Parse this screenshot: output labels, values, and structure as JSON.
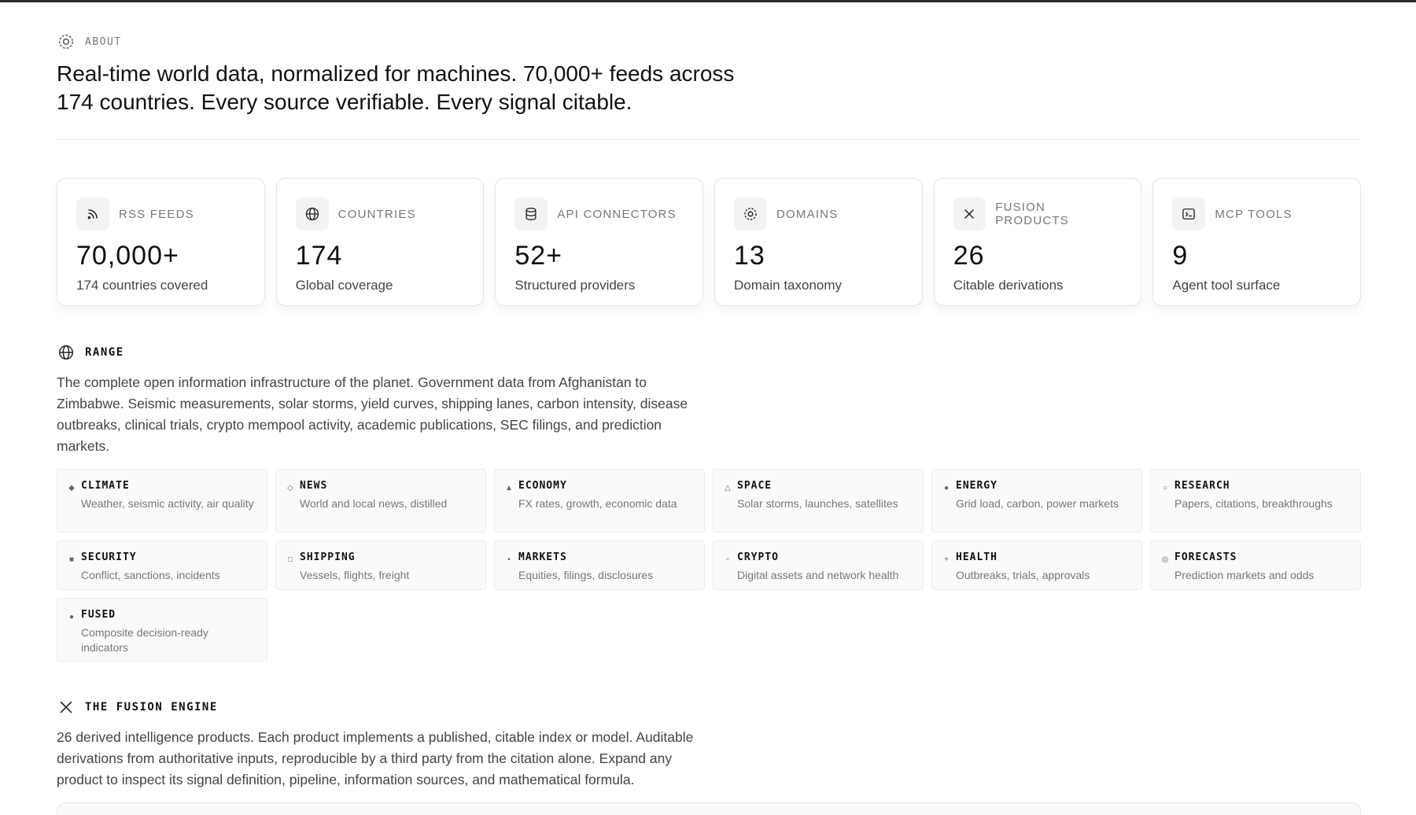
{
  "about": {
    "label": "ABOUT",
    "headline": "Real-time world data, normalized for machines. 70,000+ feeds across 174 countries. Every source verifiable. Every signal citable."
  },
  "stats": [
    {
      "icon": "rss-icon",
      "label": "RSS FEEDS",
      "value": "70,000+",
      "sub": "174 countries covered"
    },
    {
      "icon": "globe-icon",
      "label": "COUNTRIES",
      "value": "174",
      "sub": "Global coverage"
    },
    {
      "icon": "database-icon",
      "label": "API CONNECTORS",
      "value": "52+",
      "sub": "Structured providers"
    },
    {
      "icon": "target-icon",
      "label": "DOMAINS",
      "value": "13",
      "sub": "Domain taxonomy"
    },
    {
      "icon": "fusion-icon",
      "label": "FUSION PRODUCTS",
      "value": "26",
      "sub": "Citable derivations"
    },
    {
      "icon": "terminal-icon",
      "label": "MCP TOOLS",
      "value": "9",
      "sub": "Agent tool surface"
    }
  ],
  "range": {
    "label": "RANGE",
    "text": "The complete open information infrastructure of the planet. Government data from Afghanistan to Zimbabwe. Seismic measurements, solar storms, yield curves, shipping lanes, carbon intensity, disease outbreaks, clinical trials, crypto mempool activity, academic publications, SEC filings, and prediction markets."
  },
  "domains": [
    {
      "mark": "◆",
      "name": "CLIMATE",
      "desc": "Weather, seismic activity, air quality"
    },
    {
      "mark": "◇",
      "name": "NEWS",
      "desc": "World and local news, distilled"
    },
    {
      "mark": "▲",
      "name": "ECONOMY",
      "desc": "FX rates, growth, economic data"
    },
    {
      "mark": "△",
      "name": "SPACE",
      "desc": "Solar storms, launches, satellites"
    },
    {
      "mark": "●",
      "name": "ENERGY",
      "desc": "Grid load, carbon, power markets"
    },
    {
      "mark": "○",
      "name": "RESEARCH",
      "desc": "Papers, citations, breakthroughs"
    },
    {
      "mark": "■",
      "name": "SECURITY",
      "desc": "Conflict, sanctions, incidents"
    },
    {
      "mark": "□",
      "name": "SHIPPING",
      "desc": "Vessels, flights, freight"
    },
    {
      "mark": "▪",
      "name": "MARKETS",
      "desc": "Equities, filings, disclosures"
    },
    {
      "mark": "▫",
      "name": "CRYPTO",
      "desc": "Digital assets and network health"
    },
    {
      "mark": "+",
      "name": "HEALTH",
      "desc": "Outbreaks, trials, approvals"
    },
    {
      "mark": "◎",
      "name": "FORECASTS",
      "desc": "Prediction markets and odds"
    },
    {
      "mark": "●",
      "name": "FUSED",
      "desc": "Composite decision-ready indicators"
    }
  ],
  "fusion": {
    "label": "THE FUSION ENGINE",
    "text": "26 derived intelligence products. Each product implements a published, citable index or model. Auditable derivations from authoritative inputs, reproducible by a third party from the citation alone. Expand any product to inspect its signal definition, pipeline, information sources, and mathematical formula."
  }
}
